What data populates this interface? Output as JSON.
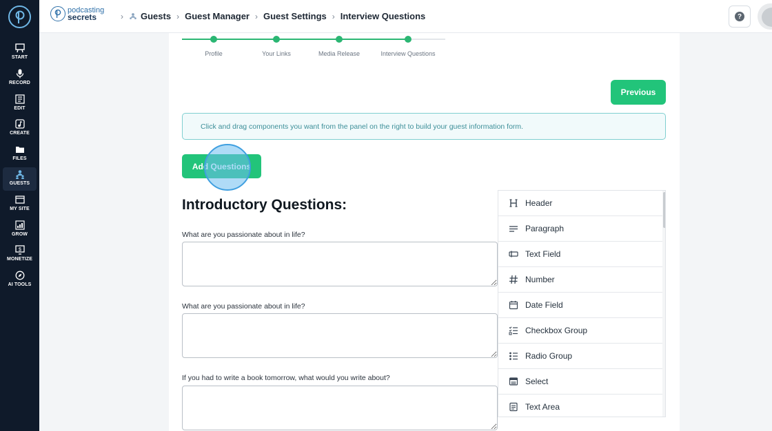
{
  "sidebar": {
    "items": [
      {
        "label": "START",
        "icon": "easel-icon"
      },
      {
        "label": "RECORD",
        "icon": "microphone-icon"
      },
      {
        "label": "EDIT",
        "icon": "edit-icon"
      },
      {
        "label": "CREATE",
        "icon": "music-note-icon"
      },
      {
        "label": "FILES",
        "icon": "folder-icon"
      },
      {
        "label": "GUESTS",
        "icon": "people-icon",
        "active": true
      },
      {
        "label": "MY SITE",
        "icon": "browser-icon"
      },
      {
        "label": "GROW",
        "icon": "bar-chart-icon"
      },
      {
        "label": "MONETIZE",
        "icon": "monitor-dollar-icon"
      },
      {
        "label": "AI TOOLS",
        "icon": "compass-icon"
      }
    ]
  },
  "brand": {
    "line1": "podcasting",
    "line2": "secrets"
  },
  "breadcrumb": {
    "items": [
      "Guests",
      "Guest Manager",
      "Guest Settings",
      "Interview Questions"
    ]
  },
  "header": {
    "help_label": "?"
  },
  "stepper": {
    "steps": [
      "Profile",
      "Your Links",
      "Media Release",
      "Interview Questions"
    ],
    "completed": 4
  },
  "buttons": {
    "previous": "Previous",
    "add_questions": "Add Questions"
  },
  "info": {
    "text": "Click and drag components you want from the panel on the right to build your guest information form."
  },
  "form": {
    "title": "Introductory Questions:",
    "questions": [
      {
        "label": "What are you passionate about in life?",
        "value": ""
      },
      {
        "label": "What are you passionate about in life?",
        "value": ""
      },
      {
        "label": "If you had to write a book tomorrow, what would you write about?",
        "value": ""
      }
    ]
  },
  "components": {
    "items": [
      {
        "label": "Header",
        "icon": "heading-icon"
      },
      {
        "label": "Paragraph",
        "icon": "paragraph-icon"
      },
      {
        "label": "Text Field",
        "icon": "text-field-icon"
      },
      {
        "label": "Number",
        "icon": "hash-icon"
      },
      {
        "label": "Date Field",
        "icon": "calendar-icon"
      },
      {
        "label": "Checkbox Group",
        "icon": "checklist-icon"
      },
      {
        "label": "Radio Group",
        "icon": "radio-list-icon"
      },
      {
        "label": "Select",
        "icon": "select-icon"
      },
      {
        "label": "Text Area",
        "icon": "textarea-icon"
      }
    ]
  },
  "colors": {
    "accent": "#22c47a",
    "sidebar": "#0f1a2a",
    "info_border": "#7fcfd0"
  }
}
